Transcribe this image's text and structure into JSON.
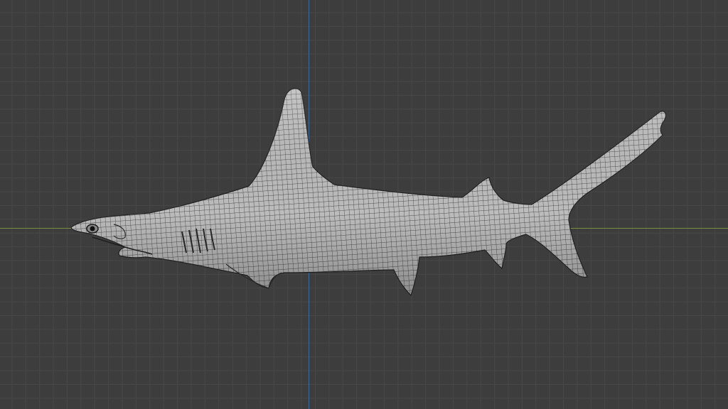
{
  "viewport": {
    "mode": "wireframe-overlay",
    "background_color": "#3d3d3d",
    "grid_color": "#474747",
    "axis_x_color": "#7a8f3a",
    "axis_z_color": "#3f6a98"
  },
  "model": {
    "object": "hammerhead-shark-mesh",
    "surface_color": "#b9b9b9",
    "wire_color": "#2a2a2a"
  }
}
